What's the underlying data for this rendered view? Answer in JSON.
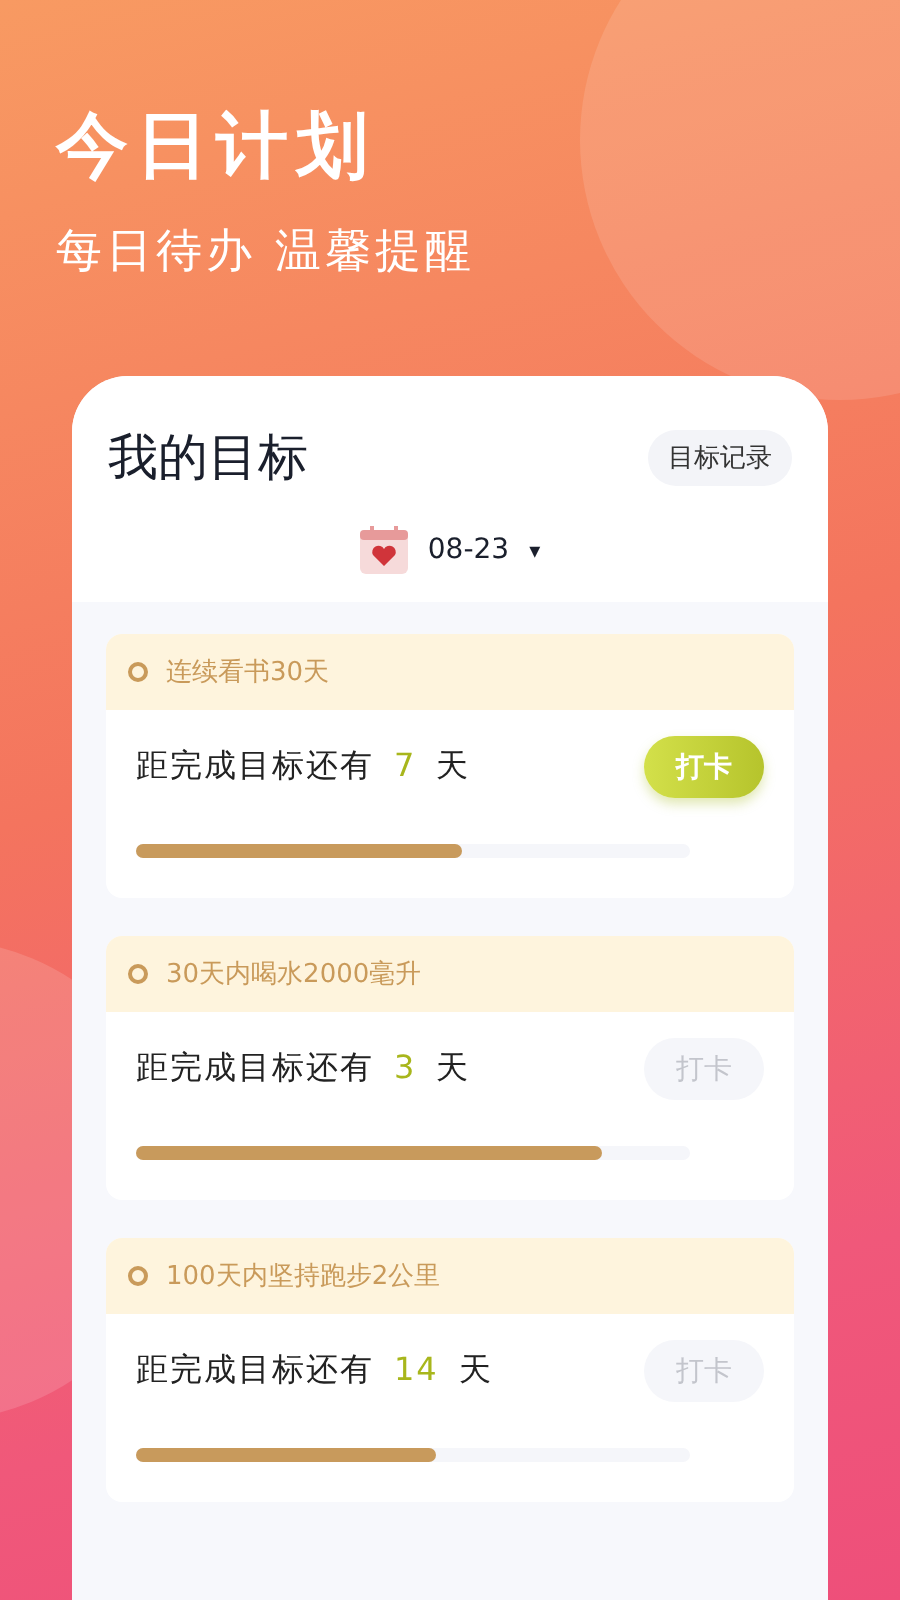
{
  "header": {
    "title": "今日计划",
    "subtitle": "每日待办 温馨提醒"
  },
  "panel": {
    "title": "我的目标",
    "record_button": "目标记录",
    "date": "08-23",
    "date_caret": "▾"
  },
  "goals": [
    {
      "name": "连续看书30天",
      "prefix": "距完成目标还有",
      "count": "7",
      "unit": "天",
      "button": "打卡",
      "enabled": true,
      "level": 0.59
    },
    {
      "name": "30天内喝水2000毫升",
      "prefix": "距完成目标还有",
      "count": "3",
      "unit": "天",
      "button": "打卡",
      "enabled": false,
      "level": 0.84
    },
    {
      "name": "100天内坚持跑步2公里",
      "prefix": "距完成目标还有",
      "count": "14",
      "unit": "天",
      "button": "打卡",
      "enabled": false,
      "level": 0.54
    }
  ]
}
